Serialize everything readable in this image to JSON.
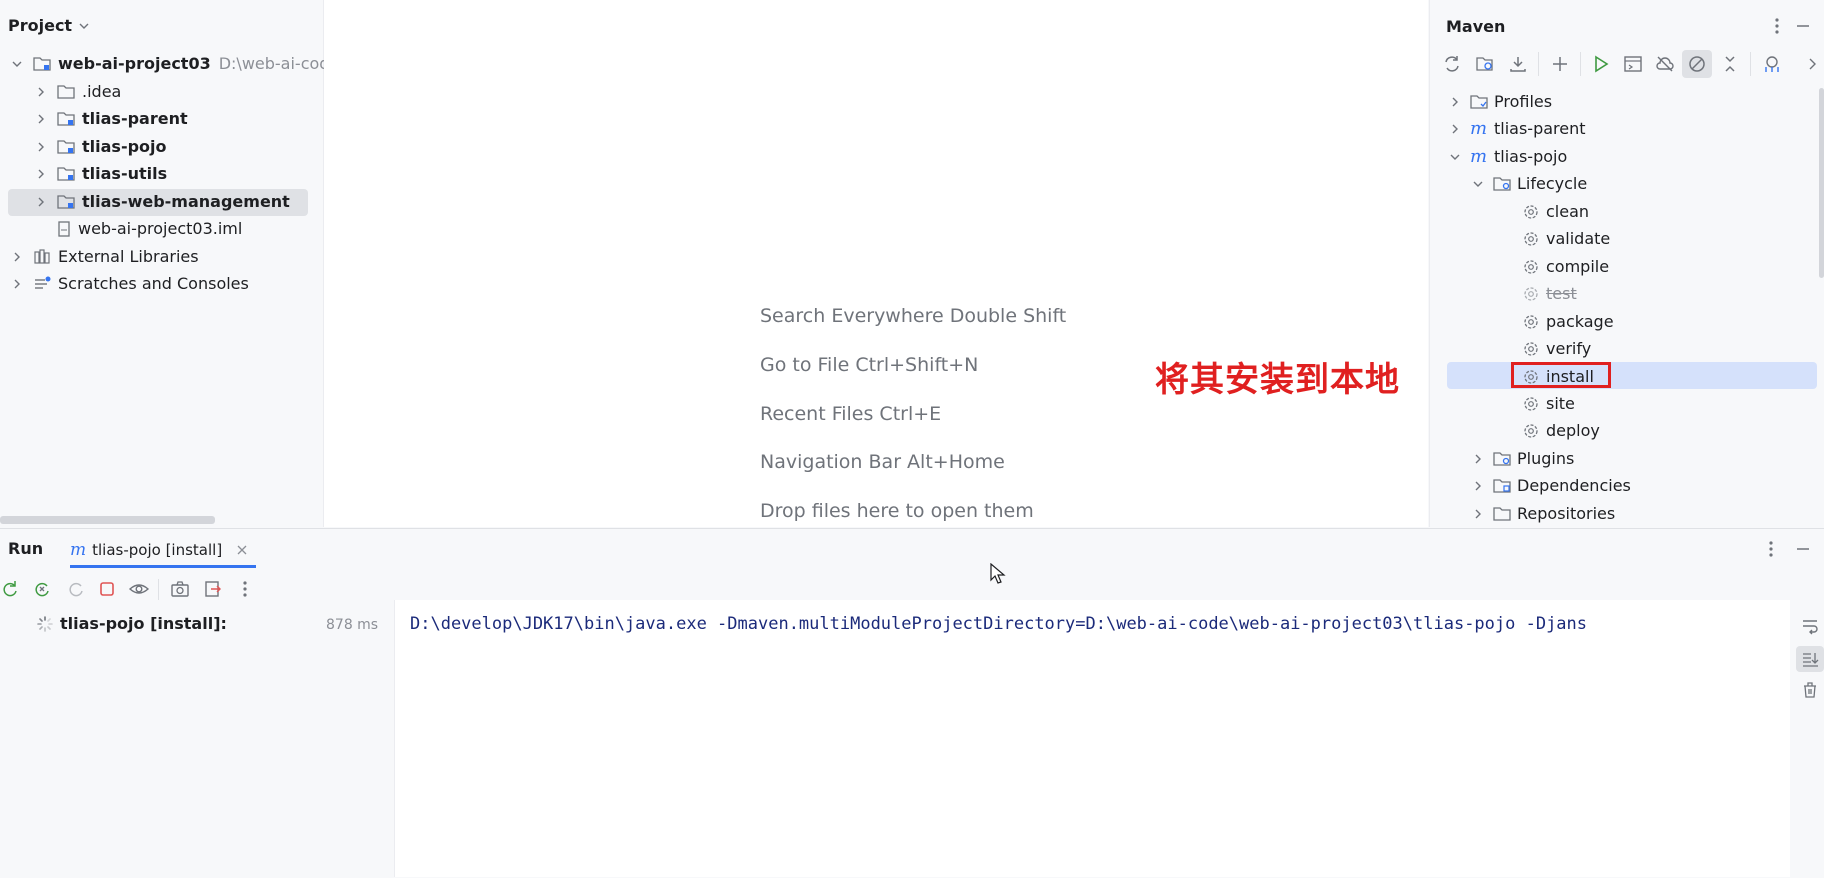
{
  "project": {
    "title": "Project",
    "root": {
      "name": "web-ai-project03",
      "path": "D:\\web-ai-code"
    },
    "items": [
      {
        "label": ".idea"
      },
      {
        "label": "tlias-parent"
      },
      {
        "label": "tlias-pojo"
      },
      {
        "label": "tlias-utils"
      },
      {
        "label": "tlias-web-management"
      },
      {
        "label": "web-ai-project03.iml"
      }
    ],
    "external": "External Libraries",
    "scratches": "Scratches and Consoles"
  },
  "editor": {
    "hints": [
      "Search Everywhere Double Shift",
      "Go to File Ctrl+Shift+N",
      "Recent Files Ctrl+E",
      "Navigation Bar Alt+Home",
      "Drop files here to open them"
    ],
    "annotation": "将其安装到本地"
  },
  "maven": {
    "title": "Maven",
    "profiles": "Profiles",
    "parent": "tlias-parent",
    "pojo": "tlias-pojo",
    "lifecycle": "Lifecycle",
    "phases": [
      {
        "label": "clean"
      },
      {
        "label": "validate"
      },
      {
        "label": "compile"
      },
      {
        "label": "test"
      },
      {
        "label": "package"
      },
      {
        "label": "verify"
      },
      {
        "label": "install"
      },
      {
        "label": "site"
      },
      {
        "label": "deploy"
      }
    ],
    "plugins": "Plugins",
    "dependencies": "Dependencies",
    "repositories": "Repositories"
  },
  "run": {
    "title": "Run",
    "tab": "tlias-pojo [install]",
    "tree_item": "tlias-pojo [install]:",
    "duration": "878 ms",
    "console": "D:\\develop\\JDK17\\bin\\java.exe -Dmaven.multiModuleProjectDirectory=D:\\web-ai-code\\web-ai-project03\\tlias-pojo -Djans"
  },
  "colors": {
    "accent": "#3574f0",
    "selection": "#d5e1fb",
    "annotation": "#e02020"
  }
}
